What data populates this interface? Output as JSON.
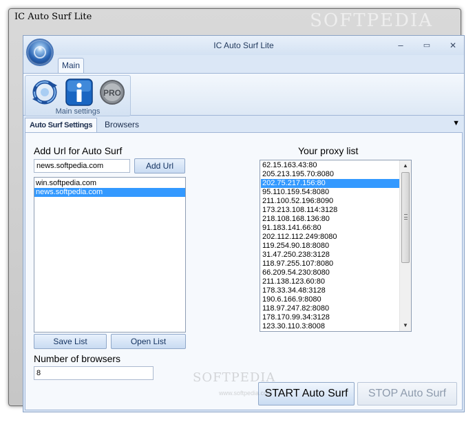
{
  "outer_window": {
    "title": "IC Auto Surf Lite",
    "watermark": "SOFTPEDIA"
  },
  "window": {
    "title": "IC Auto Surf Lite",
    "minimize": "‒",
    "maximize": "▭",
    "close": "✕"
  },
  "ribbon": {
    "tab_main": "Main",
    "group_label": "Main settings",
    "icons": [
      "refresh-icon",
      "info-icon",
      "pro-icon"
    ],
    "pro_text": "PRO"
  },
  "tabs": {
    "items": [
      "Auto Surf Settings",
      "Browsers"
    ],
    "active": "Auto Surf Settings",
    "dropdown": "▼"
  },
  "left_panel": {
    "add_url_label": "Add Url for Auto Surf",
    "url_input_value": "news.softpedia.com",
    "add_url_button": "Add Url",
    "urls": [
      "win.softpedia.com",
      "news.softpedia.com"
    ],
    "selected_url": "news.softpedia.com",
    "save_list_button": "Save List",
    "open_list_button": "Open List",
    "num_browsers_label": "Number of browsers",
    "num_browsers_value": "8"
  },
  "proxy_panel": {
    "label": "Your proxy list",
    "proxies": [
      "62.15.163.43:80",
      "205.213.195.70:8080",
      "202.75.217.156:80",
      "95.110.159.54:8080",
      "211.100.52.196:8090",
      "173.213.108.114:3128",
      "218.108.168.136:80",
      "91.183.141.66:80",
      "202.112.112.249:8080",
      "119.254.90.18:8080",
      "31.47.250.238:3128",
      "118.97.255.107:8080",
      "66.209.54.230:8080",
      "211.138.123.60:80",
      "178.33.34.48:3128",
      "190.6.166.9:8080",
      "118.97.247.82:8080",
      "178.170.99.34:3128",
      "123.30.110.3:8008"
    ],
    "selected_proxy": "202.75.217.156:80"
  },
  "actions": {
    "start_button": "START Auto Surf",
    "stop_button": "STOP Auto Surf"
  },
  "overlay": {
    "watermark_center": "SOFTPEDIA",
    "watermark_small": "www.softpedia.com"
  }
}
